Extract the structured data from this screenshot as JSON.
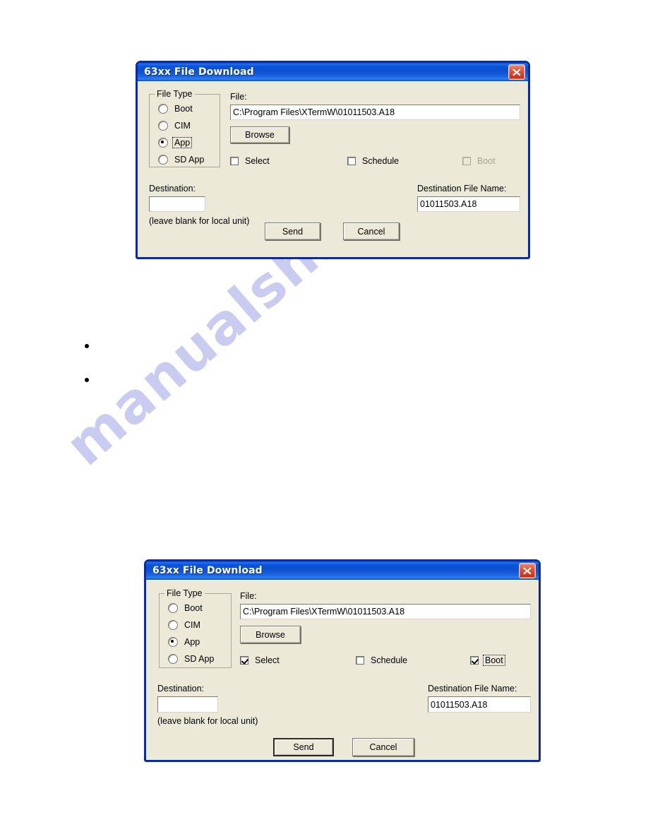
{
  "page": {
    "background": "#ffffff",
    "watermark": "manualshive.com",
    "watermark_color": "#c9cbf0"
  },
  "bullets": [
    {
      "text": ""
    },
    {
      "text": ""
    }
  ],
  "dialogs": [
    {
      "id": "dialog-top",
      "title": "63xx File Download",
      "close_tooltip": "Close",
      "file_type": {
        "legend": "File Type",
        "options": [
          {
            "label": "Boot",
            "checked": false,
            "focused": false
          },
          {
            "label": "CIM",
            "checked": false,
            "focused": false
          },
          {
            "label": "App",
            "checked": true,
            "focused": true
          },
          {
            "label": "SD App",
            "checked": false,
            "focused": false
          }
        ]
      },
      "file": {
        "label": "File:",
        "value": "C:\\Program Files\\XTermW\\01011503.A18",
        "placeholder": ""
      },
      "browse_label": "Browse",
      "checkboxes": [
        {
          "name": "select",
          "label": "Select",
          "checked": false,
          "disabled": false,
          "focused": false
        },
        {
          "name": "schedule",
          "label": "Schedule",
          "checked": false,
          "disabled": false,
          "focused": false
        },
        {
          "name": "boot",
          "label": "Boot",
          "checked": false,
          "disabled": true,
          "focused": false
        }
      ],
      "destination": {
        "label": "Destination:",
        "value": "",
        "hint": "(leave blank for local unit)"
      },
      "destination_file": {
        "label": "Destination File Name:",
        "value": "01011503.A18"
      },
      "buttons": [
        {
          "name": "send",
          "label": "Send",
          "default": false
        },
        {
          "name": "cancel",
          "label": "Cancel",
          "default": false
        }
      ]
    },
    {
      "id": "dialog-bottom",
      "title": "63xx File Download",
      "close_tooltip": "Close",
      "file_type": {
        "legend": "File Type",
        "options": [
          {
            "label": "Boot",
            "checked": false,
            "focused": false
          },
          {
            "label": "CIM",
            "checked": false,
            "focused": false
          },
          {
            "label": "App",
            "checked": true,
            "focused": false
          },
          {
            "label": "SD App",
            "checked": false,
            "focused": false
          }
        ]
      },
      "file": {
        "label": "File:",
        "value": "C:\\Program Files\\XTermW\\01011503.A18",
        "placeholder": ""
      },
      "browse_label": "Browse",
      "checkboxes": [
        {
          "name": "select",
          "label": "Select",
          "checked": true,
          "disabled": false,
          "focused": false
        },
        {
          "name": "schedule",
          "label": "Schedule",
          "checked": false,
          "disabled": false,
          "focused": false
        },
        {
          "name": "boot",
          "label": "Boot",
          "checked": true,
          "disabled": false,
          "focused": true
        }
      ],
      "destination": {
        "label": "Destination:",
        "value": "",
        "hint": "(leave blank for local unit)"
      },
      "destination_file": {
        "label": "Destination File Name:",
        "value": "01011503.A18"
      },
      "buttons": [
        {
          "name": "send",
          "label": "Send",
          "default": true
        },
        {
          "name": "cancel",
          "label": "Cancel",
          "default": false
        }
      ]
    }
  ],
  "colors": {
    "titlebar_blue": "#0b52d8",
    "dialog_face": "#ece9d8",
    "dialog_border": "#0a2c9e",
    "close_red": "#c62b12"
  }
}
